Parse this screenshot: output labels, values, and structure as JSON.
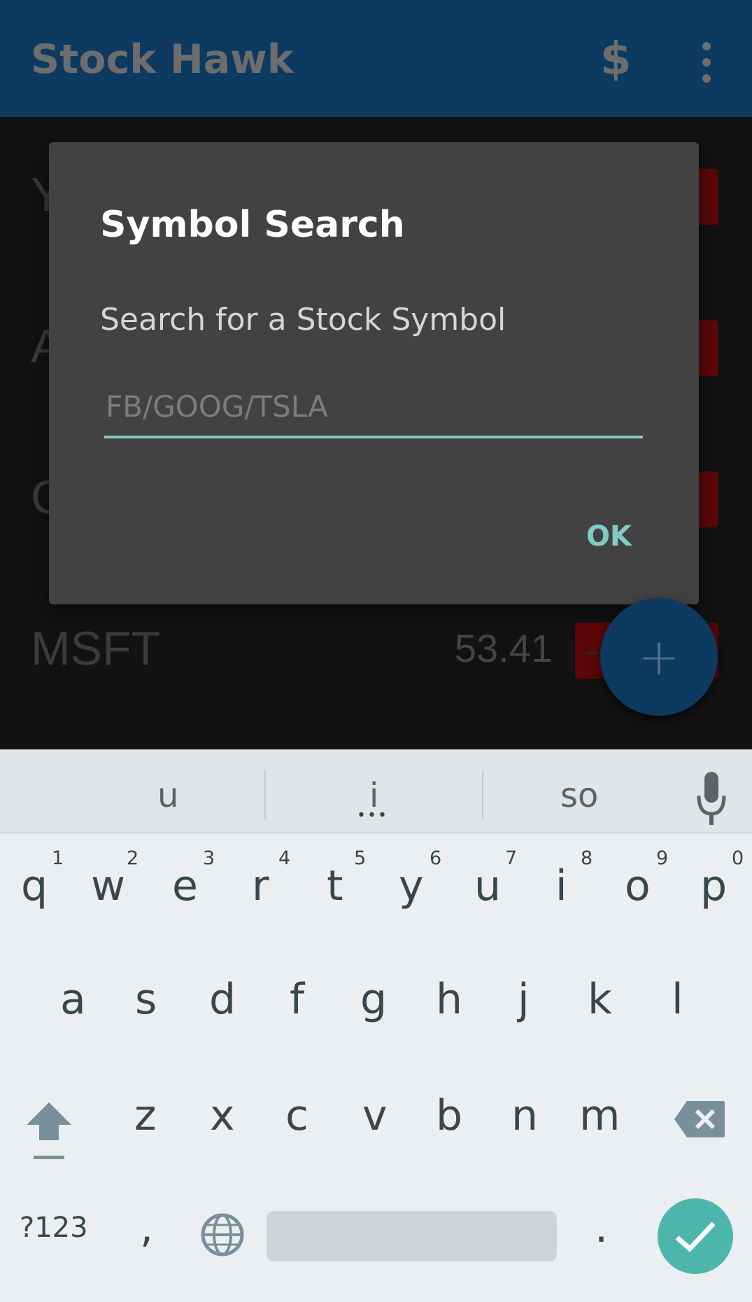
{
  "app": {
    "title": "Stock Hawk",
    "currency_icon_glyph": "$"
  },
  "stocks": [
    {
      "symbol": "Y",
      "price": "",
      "change": "%"
    },
    {
      "symbol": "A",
      "price": "",
      "change": "%"
    },
    {
      "symbol": "G",
      "price": "",
      "change": "%"
    },
    {
      "symbol": "MSFT",
      "price": "53.41",
      "change": "-("
    }
  ],
  "dialog": {
    "title": "Symbol Search",
    "message": "Search for a Stock Symbol",
    "input_placeholder": "FB/GOOG/TSLA",
    "input_value": "",
    "ok_label": "OK"
  },
  "fab": {
    "label": "+"
  },
  "keyboard": {
    "suggestions": [
      "u",
      "i",
      "so"
    ],
    "suggestion_more": "•••",
    "row1": [
      {
        "key": "q",
        "hint": "1"
      },
      {
        "key": "w",
        "hint": "2"
      },
      {
        "key": "e",
        "hint": "3"
      },
      {
        "key": "r",
        "hint": "4"
      },
      {
        "key": "t",
        "hint": "5"
      },
      {
        "key": "y",
        "hint": "6"
      },
      {
        "key": "u",
        "hint": "7"
      },
      {
        "key": "i",
        "hint": "8"
      },
      {
        "key": "o",
        "hint": "9"
      },
      {
        "key": "p",
        "hint": "0"
      }
    ],
    "row2": [
      "a",
      "s",
      "d",
      "f",
      "g",
      "h",
      "j",
      "k",
      "l"
    ],
    "row3": [
      "z",
      "x",
      "c",
      "v",
      "b",
      "n",
      "m"
    ],
    "symbols_label": "?123",
    "comma_label": ",",
    "period_label": "."
  },
  "colors": {
    "appbar": "#0c3a60",
    "accent": "#80cbc4",
    "enter_key": "#4db6ac",
    "dialog_bg": "#424242"
  }
}
